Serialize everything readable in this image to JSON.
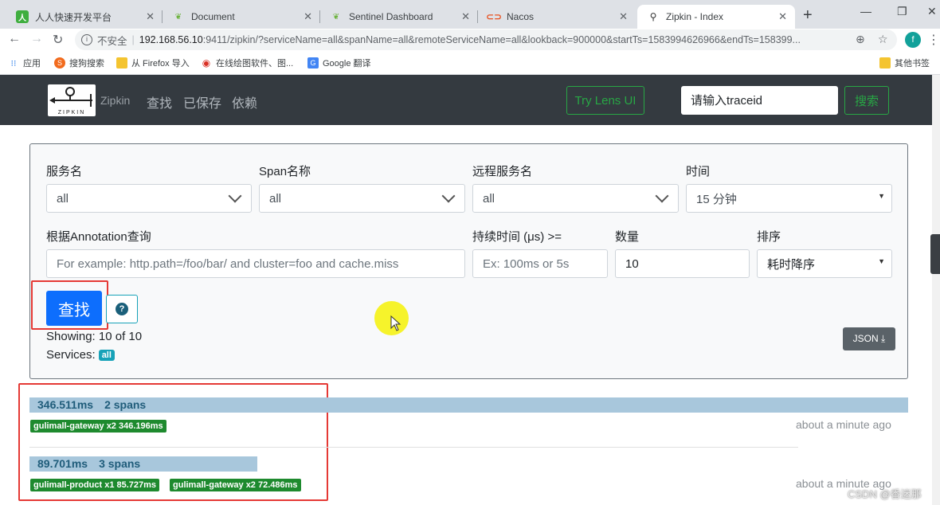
{
  "browser": {
    "tabs": [
      {
        "title": "人人快速开发平台",
        "favicon": "renren-icon"
      },
      {
        "title": "Document",
        "favicon": "leaf-icon"
      },
      {
        "title": "Sentinel Dashboard",
        "favicon": "leaf-icon"
      },
      {
        "title": "Nacos",
        "favicon": "nacos-icon"
      },
      {
        "title": "Zipkin - Index",
        "favicon": "zipkin-icon"
      }
    ],
    "tab_close": "✕",
    "new_tab": "+",
    "address": {
      "insecure_label": "不安全",
      "host": "192.168.56.10",
      "rest": ":9411/zipkin/?serviceName=all&spanName=all&remoteServiceName=all&lookback=900000&startTs=1583994626966&endTs=158399..."
    },
    "profile_initial": "f",
    "bookmarks": [
      {
        "label": "应用",
        "icon": "apps-grid-icon"
      },
      {
        "label": "搜狗搜索",
        "icon": "sogou-icon"
      },
      {
        "label": "从 Firefox 导入",
        "icon": "folder-icon"
      },
      {
        "label": "在线绘图软件、图...",
        "icon": "chrome-icon"
      },
      {
        "label": "Google 翻译",
        "icon": "translate-icon"
      },
      {
        "label": "其他书签",
        "icon": "folder-icon"
      }
    ]
  },
  "header": {
    "logo_text": "ZIPKIN",
    "brand": "Zipkin",
    "nav": [
      "查找",
      "已保存",
      "依赖"
    ],
    "lens_button": "Try Lens UI",
    "trace_placeholder": "请输入traceid",
    "search_button": "搜索"
  },
  "search": {
    "service_label": "服务名",
    "service_value": "all",
    "span_label": "Span名称",
    "span_value": "all",
    "remote_label": "远程服务名",
    "remote_value": "all",
    "time_label": "时间",
    "time_value": "15 分钟",
    "annotation_label": "根据Annotation查询",
    "annotation_placeholder": "For example: http.path=/foo/bar/ and cluster=foo and cache.miss",
    "duration_label": "持续时间 (μs) >=",
    "duration_placeholder": "Ex: 100ms or 5s",
    "count_label": "数量",
    "count_value": "10",
    "sort_label": "排序",
    "sort_value": "耗时降序",
    "find_button": "查找",
    "help_glyph": "?",
    "showing": "Showing: 10 of 10",
    "services_label": "Services:",
    "services_badge": "all",
    "json_button": "JSON"
  },
  "results": [
    {
      "duration": "346.511ms",
      "spans": "2 spans",
      "bar_fraction": 1.0,
      "tags": [
        "gulimall-gateway x2 346.196ms"
      ],
      "ago": "about a minute ago"
    },
    {
      "duration": "89.701ms",
      "spans": "3 spans",
      "bar_fraction": 0.2589,
      "tags": [
        "gulimall-product x1 85.727ms",
        "gulimall-gateway x2 72.486ms"
      ],
      "ago": "about a minute ago"
    }
  ],
  "watermark": "CSDN @香迷那",
  "colors": {
    "header_bg": "#343a40",
    "primary": "#0d6efd",
    "success": "#28a745",
    "trace_bar": "#a8c7dc",
    "service_tag": "#1e8a2e",
    "highlight_box": "#e53935"
  }
}
